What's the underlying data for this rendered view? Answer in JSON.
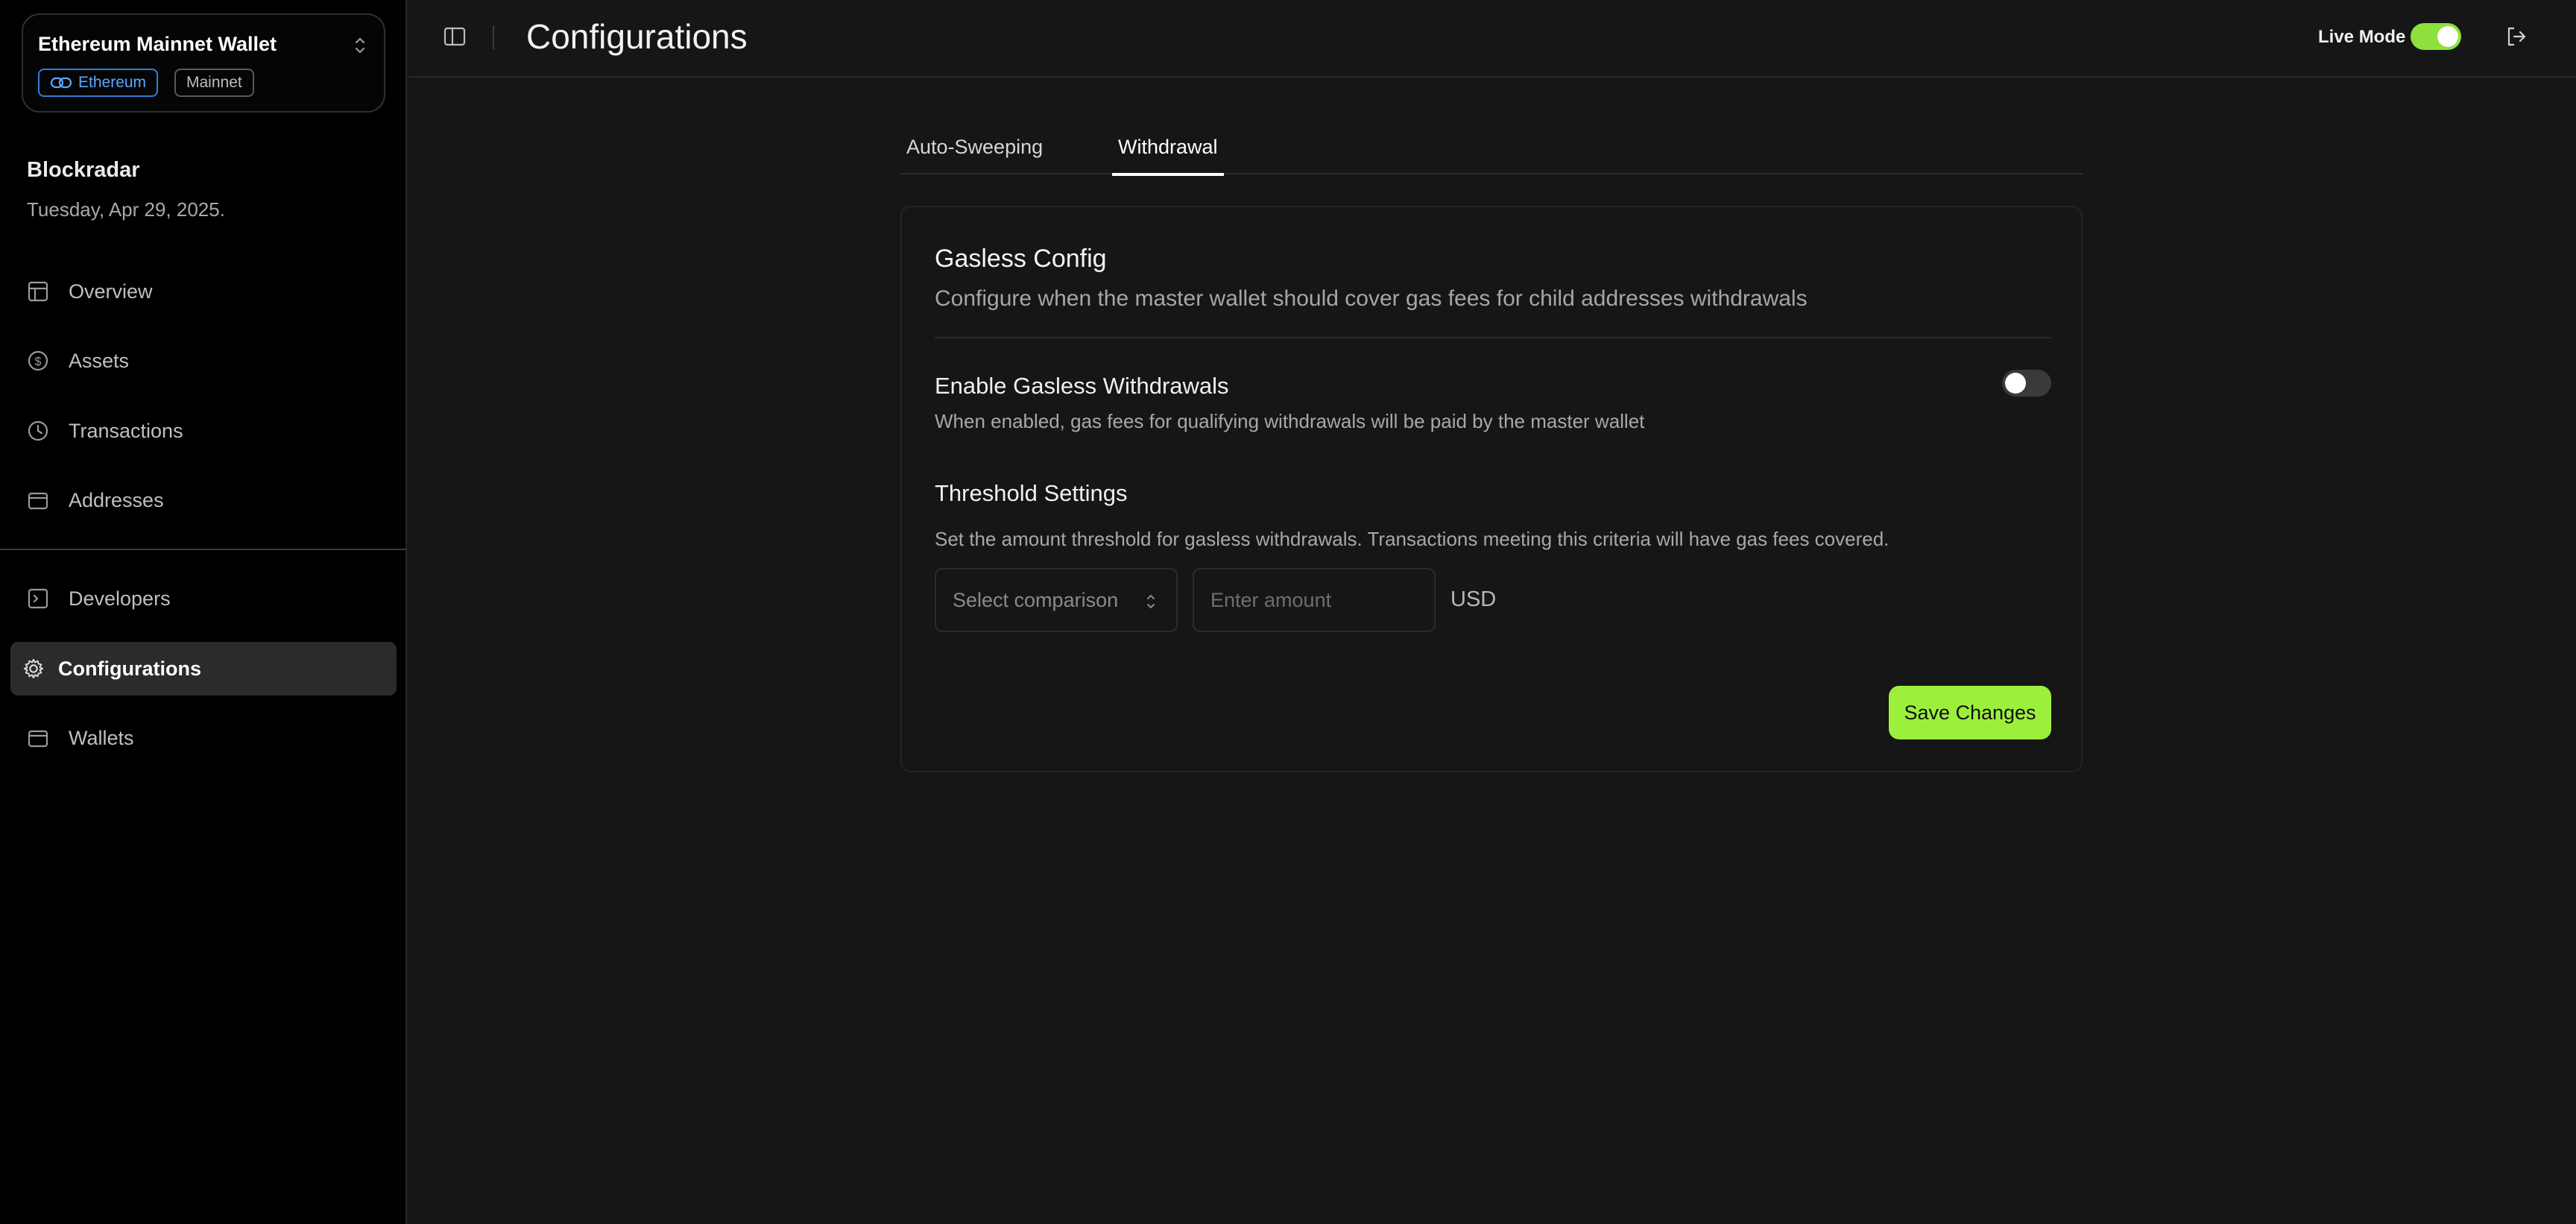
{
  "wallet": {
    "name": "Ethereum Mainnet Wallet",
    "chain_badge": "Ethereum",
    "network_badge": "Mainnet"
  },
  "org": {
    "name": "Blockradar",
    "date": "Tuesday, Apr 29, 2025."
  },
  "nav": {
    "primary": [
      {
        "label": "Overview",
        "icon": "layout-icon"
      },
      {
        "label": "Assets",
        "icon": "dollar-circle-icon"
      },
      {
        "label": "Transactions",
        "icon": "clock-icon"
      },
      {
        "label": "Addresses",
        "icon": "wallet-icon"
      }
    ],
    "secondary": [
      {
        "label": "Developers",
        "icon": "terminal-icon"
      },
      {
        "label": "Configurations",
        "icon": "gear-icon",
        "active": true
      },
      {
        "label": "Wallets",
        "icon": "wallet-icon"
      }
    ]
  },
  "header": {
    "title": "Configurations",
    "live_mode_label": "Live Mode",
    "live_mode_on": true
  },
  "tabs": [
    {
      "label": "Auto-Sweeping",
      "active": false
    },
    {
      "label": "Withdrawal",
      "active": true
    }
  ],
  "gasless": {
    "title": "Gasless Config",
    "description": "Configure when the master wallet should cover gas fees for child addresses withdrawals",
    "enable_title": "Enable Gasless Withdrawals",
    "enable_description": "When enabled, gas fees for qualifying withdrawals will be paid by the master wallet",
    "enabled": false
  },
  "threshold": {
    "title": "Threshold Settings",
    "description": "Set the amount threshold for gasless withdrawals. Transactions meeting this criteria will have gas fees covered.",
    "comparison_placeholder": "Select comparison",
    "amount_placeholder": "Enter amount",
    "currency": "USD"
  },
  "actions": {
    "save_label": "Save Changes"
  },
  "colors": {
    "accent": "#9cf03c",
    "live_toggle": "#8ee03c",
    "chain_badge": "#2f7fd8",
    "sidebar_bg": "#000000",
    "main_bg": "#161616"
  }
}
